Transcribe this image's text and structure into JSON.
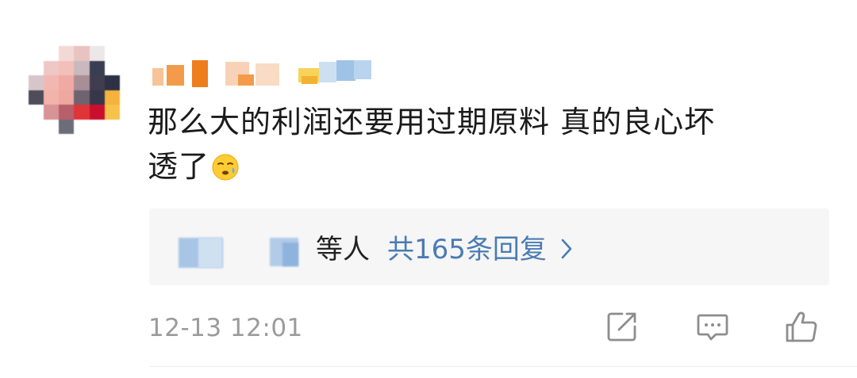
{
  "comment": {
    "text_line1": "那么大的利润还要用过期原料 真的良心坏",
    "text_line2": "透了",
    "emoji": "sweat-emoji"
  },
  "replies": {
    "people_label": "等人",
    "count_label": "共165条回复"
  },
  "meta": {
    "timestamp": "12-13 12:01"
  },
  "actions": {
    "share": "share-icon",
    "reply": "comment-icon",
    "like": "thumbs-up-icon"
  },
  "colors": {
    "link": "#4a7cb3",
    "text": "#1b1b1b",
    "meta": "#9b9b9b",
    "reply_bg": "#f6f6f6"
  }
}
